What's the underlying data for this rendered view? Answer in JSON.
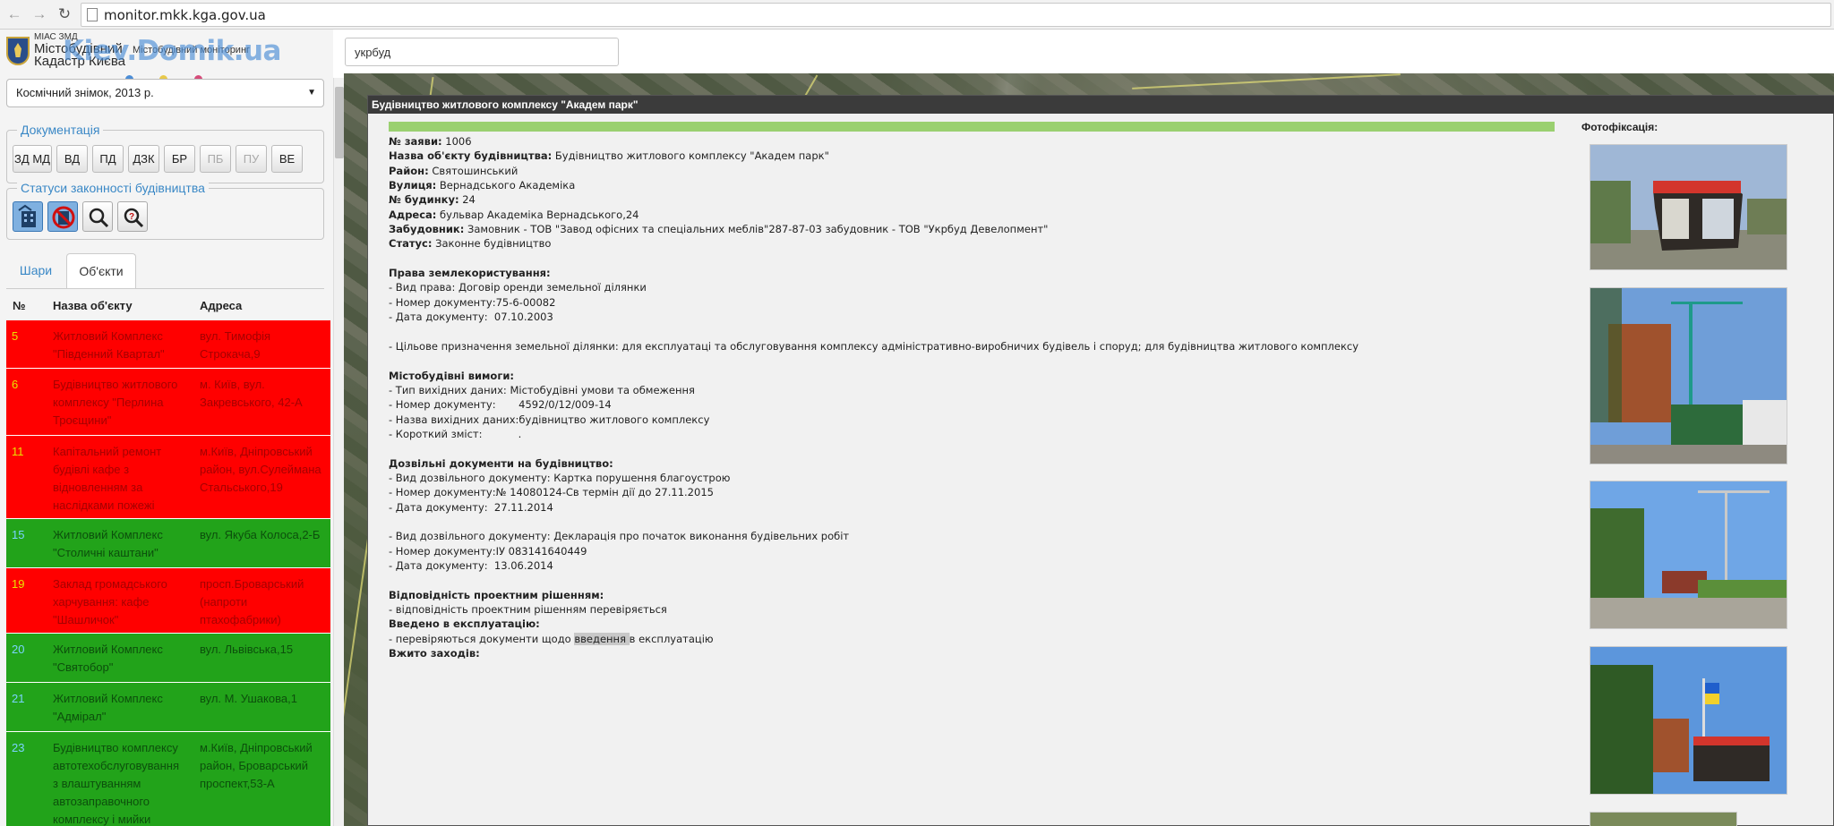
{
  "browser": {
    "url": "monitor.mkk.kga.gov.ua"
  },
  "logo": {
    "small": "МІАС ЗМД",
    "line1": "Містобудівний",
    "line2": "Кадастр Києва",
    "subtitle": "Містобудівний моніторинг",
    "watermark": "Kiev.Domik.ua"
  },
  "layer_select": {
    "value": "Космічний знімок, 2013 р."
  },
  "documentation": {
    "legend": "Документація",
    "buttons": [
      "ЗД МД",
      "ВД",
      "ПД",
      "ДЗК",
      "БР",
      "ПБ",
      "ПУ",
      "ВЕ"
    ]
  },
  "statuses": {
    "legend": "Статуси законності будівництва"
  },
  "tabs": [
    "Шари",
    "Об'єкти"
  ],
  "table": {
    "headers": [
      "№",
      "Назва об'єкту",
      "Адреса"
    ],
    "rows": [
      {
        "num": "5",
        "name": "Житловий Комплекс \"Південний Квартал\"",
        "addr": "вул. Тимофія Строкача,9",
        "color": "red"
      },
      {
        "num": "6",
        "name": "Будівництво житлового комплексу \"Перлина Троєщини\"",
        "addr": "м. Київ, вул. Закревського, 42-А",
        "color": "red"
      },
      {
        "num": "11",
        "name": "Капітальний ремонт будівлі кафе з відновленням за наслідками пожежі",
        "addr": "м.Київ, Дніпровський район, вул.Сулеймана Стальського,19",
        "color": "red"
      },
      {
        "num": "15",
        "name": "Житловий Комплекс \"Столичні каштани\"",
        "addr": "вул. Якуба Колоса,2-Б",
        "color": "green"
      },
      {
        "num": "19",
        "name": "Заклад громадського харчування: кафе \"Шашличок\"",
        "addr": "просп.Броварський (напроти птахофабрики)",
        "color": "red"
      },
      {
        "num": "20",
        "name": "Житловий Комплекс \"Святобор\"",
        "addr": "вул. Львівська,15",
        "color": "green"
      },
      {
        "num": "21",
        "name": "Житловий Комплекс \"Адмірал\"",
        "addr": "вул. М. Ушакова,1",
        "color": "green"
      },
      {
        "num": "23",
        "name": "Будівництво комплексу автотехобслуговування з влаштуванням автозаправочного комплексу і мийки",
        "addr": "м.Київ, Дніпровський район, Броварський проспект,53-А",
        "color": "green"
      }
    ]
  },
  "search": {
    "value": "укрбуд"
  },
  "popup": {
    "title": "Будівництво житлового комплексу \"Академ парк\"",
    "photo_title": "Фотофіксація:",
    "lines": [
      {
        "label": "№ заяви:",
        "text": " 1006"
      },
      {
        "label": "Назва об'єкту будівництва:",
        "text": " Будівництво житлового комплексу \"Академ парк\""
      },
      {
        "label": "Район:",
        "text": " Святошинський"
      },
      {
        "label": "Вулиця:",
        "text": " Вернадського Академіка"
      },
      {
        "label": "№ будинку:",
        "text": " 24"
      },
      {
        "label": "Адреса:",
        "text": " бульвар Академіка Вернадського,24"
      },
      {
        "label": "Забудовник:",
        "text": " Замовник - ТОВ \"Завод офісних та спеціальних меблів\"287-87-03 забудовник - ТОВ \"Укрбуд Девелопмент\""
      },
      {
        "label": "Статус:",
        "text": " Законне будівництво"
      },
      {
        "label": "",
        "text": ""
      },
      {
        "label": "Права землекористування:",
        "text": ""
      },
      {
        "label": "",
        "text": "- Вид права: Договір оренди земельної ділянки"
      },
      {
        "label": "",
        "text": "- Номер документу:75-6-00082"
      },
      {
        "label": "",
        "text": "- Дата документу:  07.10.2003"
      },
      {
        "label": "",
        "text": ""
      },
      {
        "label": "",
        "text": "- Цільове призначення земельної ділянки: для експлуатаці та обслуговування комплексу адміністративно-виробничих будівель і споруд; для будівництва житлового комплексу"
      },
      {
        "label": "",
        "text": ""
      },
      {
        "label": "Містобудівні вимоги:",
        "text": ""
      },
      {
        "label": "",
        "text": "- Тип вихідних даних: Містобудівні умови та обмеження"
      },
      {
        "label": "",
        "text": "- Номер документу:       4592/0/12/009-14"
      },
      {
        "label": "",
        "text": "- Назва вихідних даних:будівництво житлового комплексу"
      },
      {
        "label": "",
        "text": "- Короткий зміст:           ."
      },
      {
        "label": "",
        "text": ""
      },
      {
        "label": "Дозвільні документи на будівництво:",
        "text": ""
      },
      {
        "label": "",
        "text": "- Вид дозвільного документу: Картка порушення благоустрою"
      },
      {
        "label": "",
        "text": "- Номер документу:№ 14080124-Св термін дії до 27.11.2015"
      },
      {
        "label": "",
        "text": "- Дата документу:  27.11.2014"
      },
      {
        "label": "",
        "text": ""
      },
      {
        "label": "",
        "text": "- Вид дозвільного документу: Декларація про початок виконання будівельних робіт"
      },
      {
        "label": "",
        "text": "- Номер документу:ІУ 083141640449"
      },
      {
        "label": "",
        "text": "- Дата документу:  13.06.2014"
      },
      {
        "label": "",
        "text": ""
      },
      {
        "label": "Відповідність проектним рішенням:",
        "text": ""
      },
      {
        "label": "",
        "text": "- відповідність проектним рішенням перевіряється"
      },
      {
        "label": "Введено в експлуатацію:",
        "text": ""
      },
      {
        "label": "",
        "text": "- перевіряються документи щодо ",
        "hl": "введення ",
        "after": "в експлуатацію"
      },
      {
        "label": "Вжито заходів:",
        "text": ""
      }
    ]
  },
  "colors": {
    "red_row": "#ff0000",
    "green_row": "#22a31a",
    "accent": "#3a88c6",
    "progress": "#9ad070"
  }
}
